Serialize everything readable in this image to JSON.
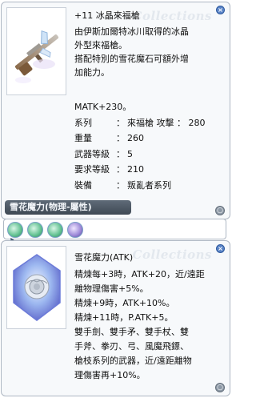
{
  "watermark": "Collections",
  "weapon": {
    "title": "+11 冰晶來福槍",
    "description": [
      "由伊斯加爾特冰川取得的冰晶",
      "外型來福槍。",
      "搭配特別的雪花魔石可額外增",
      "加能力。"
    ],
    "stats": [
      {
        "key": "MATK+230。",
        "sep": "",
        "value": ""
      },
      {
        "key": "系列",
        "sep": "：",
        "value": "來福槍 攻擊 ： 280"
      },
      {
        "key": "重量",
        "sep": "：",
        "value": "260"
      },
      {
        "key": "武器等級",
        "sep": "：",
        "value": "5"
      },
      {
        "key": "要求等級",
        "sep": "：",
        "value": "210"
      },
      {
        "key": "裝備",
        "sep": "：",
        "value": "叛亂者系列"
      }
    ],
    "slot_label": "雪花魔力(物理-屬性)"
  },
  "card": {
    "title": "雪花魔力(ATK)",
    "description": [
      "精煉每+3時，ATK+20，近/遠距",
      "離物理傷害+5%。",
      "精煉+9時，ATK+10%。",
      "精煉+11時，P.ATK+5。",
      "雙手劍、雙手矛、雙手杖、雙",
      "手斧、拳刃、弓、風魔飛鏢、",
      "槍枝系列的武器，近/遠距離物",
      "理傷害再+10%。"
    ]
  },
  "icons": {
    "close": "close-icon",
    "corner": "corner-menu-icon",
    "weapon_image": "ice-rifle-icon",
    "card_image": "snow-rose-crystal-icon",
    "slot_gem": "snowflake-gem-icon",
    "cursor": "mouse-cursor-icon"
  },
  "colors": {
    "panel_border": "#aeb7c3",
    "slot_label_bg": "#4d5865",
    "accent_blue": "#5a84c7"
  }
}
